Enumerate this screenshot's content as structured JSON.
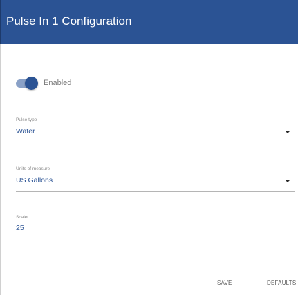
{
  "dialog": {
    "title": "Pulse In 1 Configuration",
    "header_color": "#2b5394"
  },
  "enabled_toggle": {
    "label": "Enabled",
    "checked": true
  },
  "pulse_type": {
    "label": "Pulse type",
    "value": "Water"
  },
  "units_of_measure": {
    "label": "Units of measure",
    "value": "US Gallons"
  },
  "scaler": {
    "label": "Scaler",
    "value": "25"
  },
  "actions": {
    "save_label": "SAVE",
    "defaults_label": "DEFAULTS"
  }
}
